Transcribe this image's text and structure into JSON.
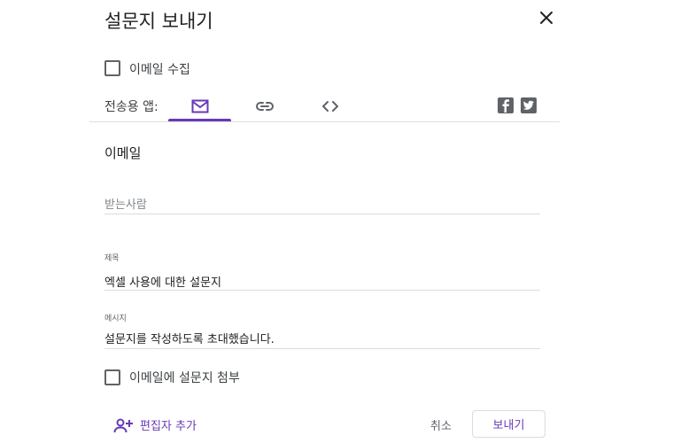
{
  "dialog": {
    "title": "설문지 보내기",
    "close_icon": "close-icon"
  },
  "collect_email": {
    "label": "이메일 수집",
    "checked": false
  },
  "send_via": {
    "label": "전송용 앱:",
    "tabs": [
      {
        "icon": "email-icon",
        "selected": true
      },
      {
        "icon": "link-icon",
        "selected": false
      },
      {
        "icon": "embed-code-icon",
        "selected": false
      }
    ],
    "social": [
      "facebook-icon",
      "twitter-icon"
    ],
    "accent_color": "#673ab7"
  },
  "email_form": {
    "heading": "이메일",
    "to": {
      "placeholder": "받는사람",
      "value": ""
    },
    "subject": {
      "label": "제목",
      "value": "엑셀 사용에 대한 설문지"
    },
    "message": {
      "label": "메시지",
      "value": "설문지를 작성하도록 초대했습니다."
    },
    "include_form": {
      "label": "이메일에 설문지 첨부",
      "checked": false
    }
  },
  "footer": {
    "add_editors_label": "편집자 추가",
    "cancel_label": "취소",
    "send_label": "보내기"
  }
}
